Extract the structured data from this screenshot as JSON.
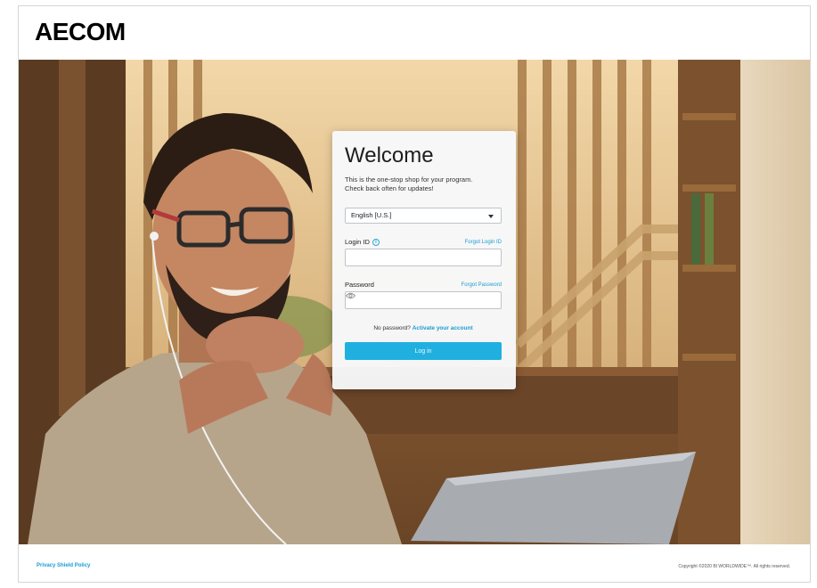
{
  "header": {
    "logo_text": "AECOM"
  },
  "login": {
    "title": "Welcome",
    "intro": "This is the one-stop shop for your program. Check back often for updates!",
    "language": {
      "selected": "English [U.S.]"
    },
    "login_id": {
      "label": "Login ID",
      "forgot_link": "Forgot Login ID",
      "value": ""
    },
    "password": {
      "label": "Password",
      "forgot_link": "Forgot Password",
      "value": ""
    },
    "no_password_text": "No password?",
    "activate_link": "Activate your account",
    "submit_label": "Log in"
  },
  "footer": {
    "privacy_link": "Privacy Shield Policy",
    "copyright": "Copyright ©2020 BI WORLDWIDE™. All rights reserved."
  },
  "colors": {
    "accent": "#20b0e0",
    "link": "#1a9bd2"
  },
  "icons": {
    "info": "info-circle-icon",
    "eye": "eye-icon",
    "select": "chevron-down-icon"
  }
}
